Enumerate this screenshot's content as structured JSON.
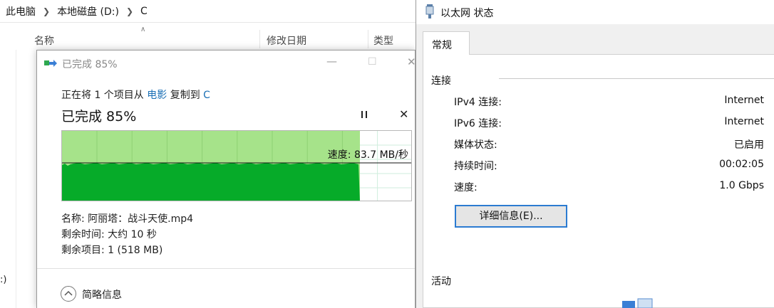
{
  "explorer": {
    "breadcrumb": [
      "此电脑",
      "本地磁盘 (D:)",
      "C"
    ],
    "columns": [
      "名称",
      "修改日期",
      "类型"
    ],
    "stray_text": ":)"
  },
  "copy_dialog": {
    "title": "已完成 85%",
    "desc_prefix": "正在将 1 个项目从",
    "desc_source": "电影",
    "desc_mid": "复制到",
    "desc_target": "C",
    "percent_text": "已完成 85%",
    "progress": 0.85,
    "speed": "速度: 83.7 MB/秒",
    "name": "名称: 阿丽塔：战斗天使.mp4",
    "time_left": "剩余时间: 大约 10 秒",
    "items_left": "剩余项目: 1 (518 MB)",
    "less_details": "简略信息",
    "colors": {
      "fill_light": "#a6e38a",
      "fill_dark": "#06ab29",
      "link": "#1a6fb5"
    }
  },
  "ethernet_status": {
    "title": "以太网 状态",
    "tab": "常规",
    "connection_group": "连接",
    "rows": [
      {
        "key": "IPv4 连接:",
        "value": "Internet"
      },
      {
        "key": "IPv6 连接:",
        "value": "Internet"
      },
      {
        "key": "媒体状态:",
        "value": "已启用"
      },
      {
        "key": "持续时间:",
        "value": "00:02:05"
      },
      {
        "key": "速度:",
        "value": "1.0 Gbps"
      }
    ],
    "details_button": "详细信息(E)...",
    "activity_group": "活动",
    "colors": {
      "focus": "#2b7bd1"
    }
  }
}
